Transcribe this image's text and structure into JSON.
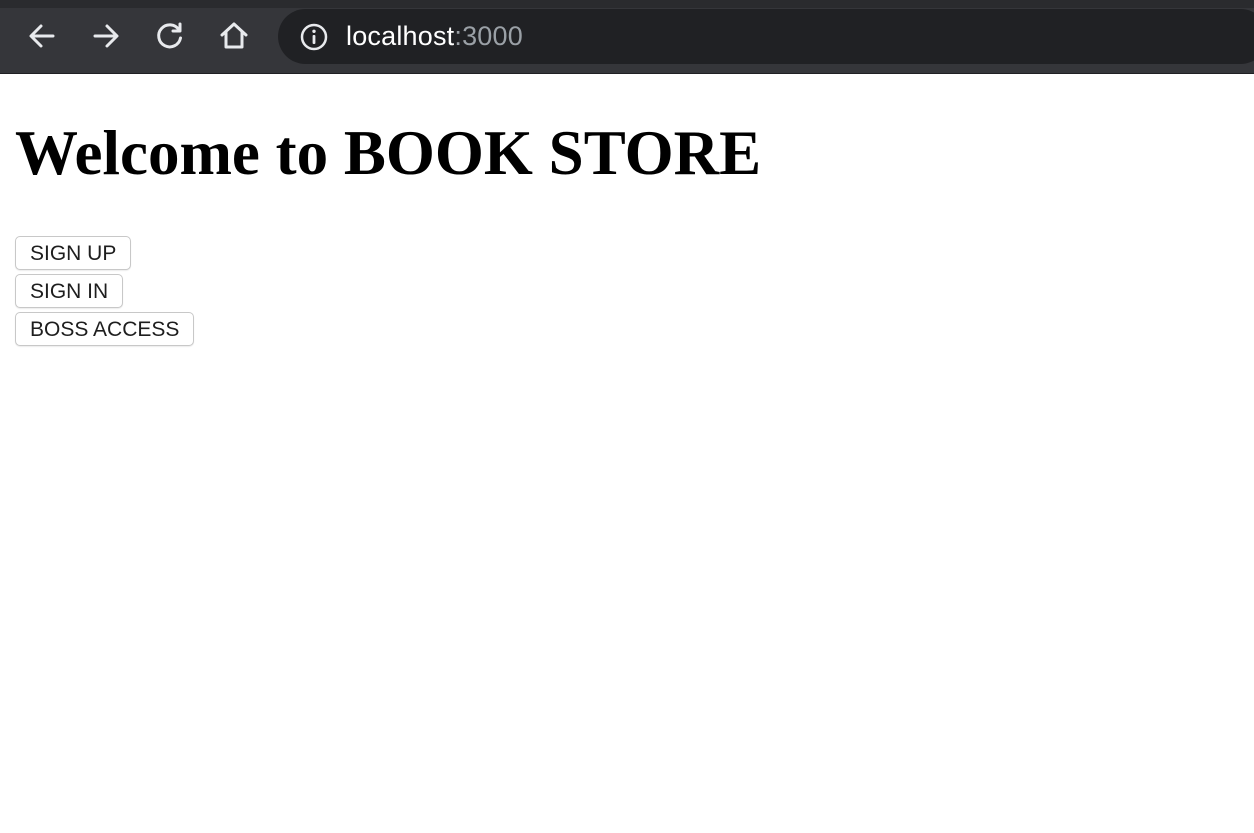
{
  "browser": {
    "url_host": "localhost",
    "url_port": ":3000",
    "icons": {
      "back": "arrow-left-icon",
      "forward": "arrow-right-icon",
      "reload": "reload-icon",
      "home": "home-icon",
      "info": "info-icon"
    },
    "colors": {
      "chrome_bg": "#35363a",
      "omnibox_bg": "#202124",
      "url_host": "#ffffff",
      "url_port": "#9aa0a6"
    }
  },
  "page": {
    "title": "Welcome to BOOK STORE",
    "buttons": [
      {
        "label": "SIGN UP"
      },
      {
        "label": "SIGN IN"
      },
      {
        "label": "BOSS ACCESS"
      }
    ]
  }
}
